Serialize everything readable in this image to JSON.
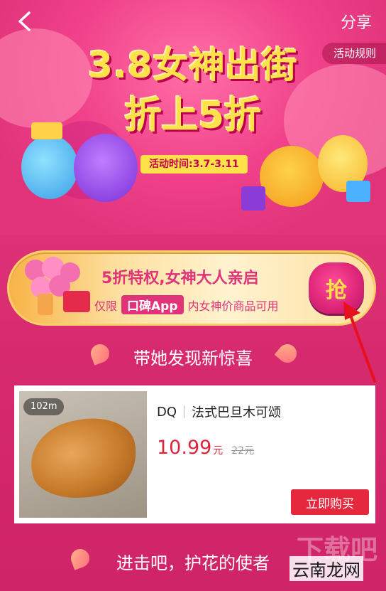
{
  "header": {
    "share_label": "分享",
    "rules_label": "活动规则"
  },
  "hero": {
    "title_line1": "3.8女神出街",
    "title_line2": "折上5折",
    "time_label": "活动时间:3.7-3.11"
  },
  "coupon": {
    "headline": "5折特权,女神大人亲启",
    "prefix": "仅限",
    "app_name": "口碑App",
    "suffix": "内女神价商品可用",
    "grab_label": "抢"
  },
  "sections": {
    "first_title": "带她发现新惊喜",
    "second_title": "进击吧，护花的使者"
  },
  "product": {
    "distance": "102m",
    "shop": "DQ",
    "name": "法式巴旦木可颂",
    "price": "10.99",
    "price_unit": "元",
    "original_price": "22元",
    "buy_label": "立即购买"
  },
  "watermark": {
    "text": "云南龙网",
    "faded_text": "下载吧"
  },
  "colors": {
    "brand_pink": "#e0337a",
    "title_yellow": "#ffe24a",
    "price_red": "#e0243a",
    "buy_button_red": "#e5283e"
  },
  "icons": [
    "back-arrow-icon",
    "flower-bouquet-icon",
    "red-envelope-icon",
    "petal-icon",
    "annotation-arrow-icon"
  ]
}
